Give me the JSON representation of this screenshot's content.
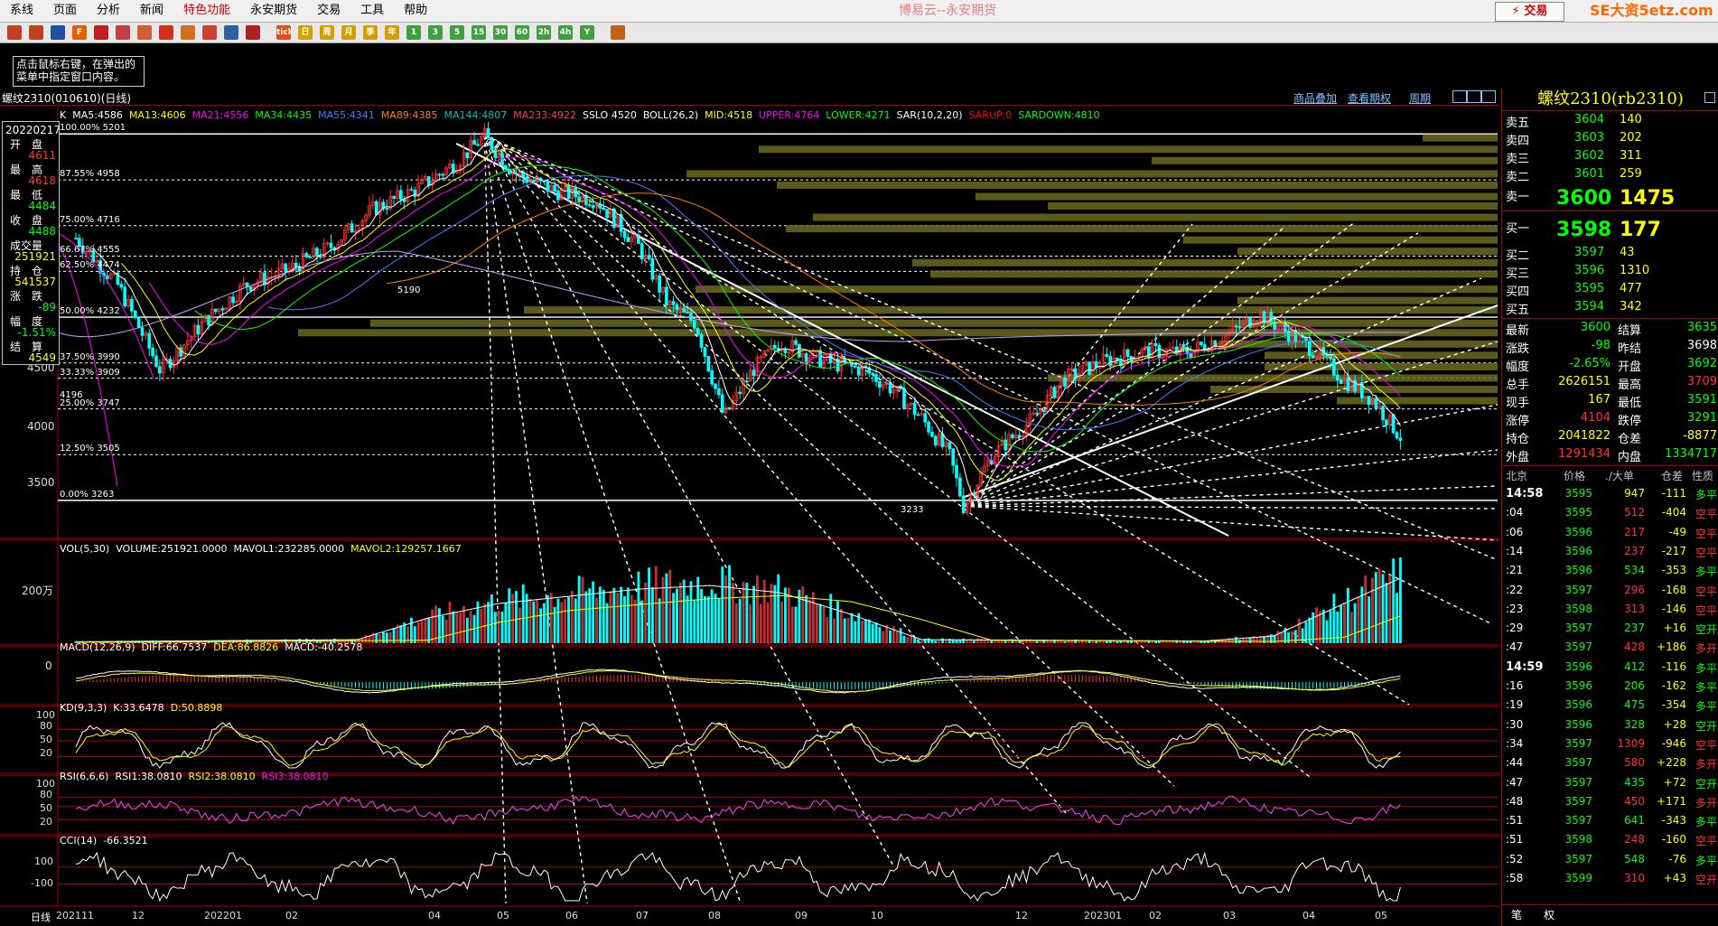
{
  "menu": {
    "items": [
      "系线",
      "页面",
      "分析",
      "新闻",
      "特色功能",
      "永安期货",
      "交易",
      "工具",
      "帮助"
    ],
    "highlight_index": 4,
    "app_title": "博易云--永安期货",
    "trade_button": "交易",
    "brand": "SE大资5etz.com"
  },
  "toolbar": {
    "icons": [
      {
        "name": "home-icon",
        "color": "#c04020",
        "text": ""
      },
      {
        "name": "pen-icon",
        "color": "#c04020",
        "text": ""
      },
      {
        "name": "window-icon",
        "color": "#2050a0",
        "text": ""
      },
      {
        "name": "f10-icon",
        "color": "#e06000",
        "text": "F"
      },
      {
        "name": "chart-icon",
        "color": "#c02020",
        "text": ""
      },
      {
        "name": "zoom-icon",
        "color": "#c04040",
        "text": ""
      },
      {
        "name": "search-icon",
        "color": "#d06030",
        "text": ""
      },
      {
        "name": "draw-icon",
        "color": "#d03020",
        "text": ""
      },
      {
        "name": "tool-icon",
        "color": "#d07020",
        "text": ""
      },
      {
        "name": "alarm-icon",
        "color": "#d04030",
        "text": ""
      },
      {
        "name": "quote-icon",
        "color": "#3060a0",
        "text": ""
      },
      {
        "name": "kline-icon",
        "color": "#b02020",
        "text": ""
      },
      {
        "name": "tick-icon",
        "color": "#e05010",
        "text": "tick"
      },
      {
        "name": "day-icon",
        "color": "#d0a000",
        "text": "日"
      },
      {
        "name": "week-icon",
        "color": "#d0a000",
        "text": "周"
      },
      {
        "name": "month-icon",
        "color": "#d0a000",
        "text": "月"
      },
      {
        "name": "season-icon",
        "color": "#d0a000",
        "text": "季"
      },
      {
        "name": "year-icon",
        "color": "#d0a000",
        "text": "年"
      },
      {
        "name": "min1-icon",
        "color": "#40a040",
        "text": "1"
      },
      {
        "name": "min3-icon",
        "color": "#40a040",
        "text": "3"
      },
      {
        "name": "min5-icon",
        "color": "#40a040",
        "text": "5"
      },
      {
        "name": "min15-icon",
        "color": "#40a040",
        "text": "15"
      },
      {
        "name": "min30-icon",
        "color": "#40a040",
        "text": "30"
      },
      {
        "name": "min60-icon",
        "color": "#40a040",
        "text": "60"
      },
      {
        "name": "hour2-icon",
        "color": "#40a040",
        "text": "2h"
      },
      {
        "name": "hour4-icon",
        "color": "#40a040",
        "text": "4h"
      },
      {
        "name": "custom-icon",
        "color": "#40a040",
        "text": "Y"
      },
      {
        "name": "calendar-icon",
        "color": "#c06020",
        "text": ""
      }
    ]
  },
  "hint": {
    "text": "点击鼠标右键，在弹出的菜单中指定窗口内容。"
  },
  "subtitle": {
    "name": "螺纹2310(010610)(日线)",
    "links": [
      "商品叠加",
      "查看期权",
      "周期"
    ]
  },
  "info": {
    "date": "20220217",
    "open_label": "开　盘",
    "open": "4611",
    "high_label": "最　高",
    "high": "4618",
    "low_label": "最　低",
    "low": "4484",
    "close_label": "收　盘",
    "close": "4488",
    "vol_label": "成交量",
    "vol": "251921",
    "oi_label": "持　仓",
    "oi": "541537",
    "chg_label": "涨　跌",
    "chg": "-89",
    "amp_label": "幅　度",
    "amp": "-1.51%",
    "settle_label": "结　算",
    "settle": "4549"
  },
  "main_header": [
    {
      "t": "K",
      "c": "#ffffff"
    },
    {
      "t": "MA5:4586",
      "c": "#ffffff"
    },
    {
      "t": "MA13:4606",
      "c": "#ffff00"
    },
    {
      "t": "MA21:4556",
      "c": "#ff00ff"
    },
    {
      "t": "MA34:4435",
      "c": "#00ff00"
    },
    {
      "t": "MA55:4341",
      "c": "#4080ff"
    },
    {
      "t": "MA89:4385",
      "c": "#ff8000"
    },
    {
      "t": "MA144:4807",
      "c": "#00c0c0"
    },
    {
      "t": "MA233:4922",
      "c": "#ff4040"
    },
    {
      "t": "SSLO 4520",
      "c": "#ffffff"
    },
    {
      "t": "BOLL(26,2)",
      "c": "#ffffff"
    },
    {
      "t": "MID:4518",
      "c": "#ffff00"
    },
    {
      "t": "UPPER:4764",
      "c": "#ff00ff"
    },
    {
      "t": "LOWER:4271",
      "c": "#00ff00"
    },
    {
      "t": "SAR(10,2,20)",
      "c": "#ffffff"
    },
    {
      "t": "SARUP:0",
      "c": "#ff0000"
    },
    {
      "t": "SARDOWN:4810",
      "c": "#00ff00"
    }
  ],
  "price_axis": [
    "4500",
    "4000",
    "3500"
  ],
  "fib_labels": [
    {
      "pct": "100.00%",
      "val": "5201"
    },
    {
      "pct": "87.55%",
      "val": "4958"
    },
    {
      "pct": "75.00%",
      "val": "4716"
    },
    {
      "pct": "66.67%",
      "val": "4555"
    },
    {
      "pct": "62.50%",
      "val": "4474"
    },
    {
      "pct": "50.00%",
      "val": "4232"
    },
    {
      "pct": "37.50%",
      "val": "3990"
    },
    {
      "pct": "33.33%",
      "val": "3909"
    },
    {
      "pct": "25.00%",
      "val": "3747"
    },
    {
      "pct": "12.50%",
      "val": "3505"
    },
    {
      "pct": "0.00%",
      "val": "3263"
    }
  ],
  "price_tags": {
    "high": "5190",
    "low": "3233",
    "mid": "4196"
  },
  "vol_header": [
    {
      "t": "VOL(5,30)",
      "c": "#ffffff"
    },
    {
      "t": "VOLUME:251921.0000",
      "c": "#ffffff"
    },
    {
      "t": "MAVOL1:232285.0000",
      "c": "#ffffff"
    },
    {
      "t": "MAVOL2:129257.1667",
      "c": "#ffff00"
    }
  ],
  "vol_axis": "200万",
  "macd_header": [
    {
      "t": "MACD(12,26,9)",
      "c": "#ffffff"
    },
    {
      "t": "DIFF:66.7537",
      "c": "#ffffff"
    },
    {
      "t": "DEA:86.8826",
      "c": "#ffff00"
    },
    {
      "t": "MACD:-40.2578",
      "c": "#ffffff"
    }
  ],
  "macd_axis": "0",
  "kd_header": [
    {
      "t": "KD(9,3,3)",
      "c": "#ffffff"
    },
    {
      "t": "K:33.6478",
      "c": "#ffffff"
    },
    {
      "t": "D:50.8898",
      "c": "#ffff00"
    }
  ],
  "kd_axis": [
    "100",
    "80",
    "50",
    "20"
  ],
  "rsi_header": [
    {
      "t": "RSI(6,6,6)",
      "c": "#ffffff"
    },
    {
      "t": "RSI1:38.0810",
      "c": "#ffffff"
    },
    {
      "t": "RSI2:38.0810",
      "c": "#ffff00"
    },
    {
      "t": "RSI3:38.0810",
      "c": "#ff00ff"
    }
  ],
  "rsi_axis": [
    "100",
    "80",
    "50",
    "20"
  ],
  "cci_header": [
    {
      "t": "CCI(14)",
      "c": "#ffffff"
    },
    {
      "t": "-66.3521",
      "c": "#ffffff"
    }
  ],
  "cci_axis": [
    "100",
    "-100"
  ],
  "date_axis": {
    "label": "日线",
    "ticks": [
      "202111",
      "12",
      "202201",
      "02",
      "04",
      "05",
      "06",
      "07",
      "08",
      "09",
      "10",
      "12",
      "202301",
      "02",
      "03",
      "04",
      "05"
    ]
  },
  "panel": {
    "title": "螺纹2310(rb2310)",
    "asks": [
      {
        "l": "卖五",
        "p": "3604",
        "v": "140"
      },
      {
        "l": "卖四",
        "p": "3603",
        "v": "202"
      },
      {
        "l": "卖三",
        "p": "3602",
        "v": "311"
      },
      {
        "l": "卖二",
        "p": "3601",
        "v": "259"
      }
    ],
    "ask1": {
      "l": "卖一",
      "p": "3600",
      "v": "1475"
    },
    "bid1": {
      "l": "买一",
      "p": "3598",
      "v": "177"
    },
    "bids": [
      {
        "l": "买二",
        "p": "3597",
        "v": "43"
      },
      {
        "l": "买三",
        "p": "3596",
        "v": "1310"
      },
      {
        "l": "买四",
        "p": "3595",
        "v": "477"
      },
      {
        "l": "买五",
        "p": "3594",
        "v": "342"
      }
    ],
    "stats": [
      {
        "l1": "最新",
        "v1": "3600",
        "c1": "#00ff00",
        "l2": "结算",
        "v2": "3635",
        "c2": "#00ff00"
      },
      {
        "l1": "涨跌",
        "v1": "-98",
        "c1": "#00ff00",
        "l2": "昨结",
        "v2": "3698",
        "c2": "#ffffff"
      },
      {
        "l1": "幅度",
        "v1": "-2.65%",
        "c1": "#00ff00",
        "l2": "开盘",
        "v2": "3692",
        "c2": "#00ff00"
      },
      {
        "l1": "总手",
        "v1": "2626151",
        "c1": "#ffff00",
        "l2": "最高",
        "v2": "3709",
        "c2": "#ff3030"
      },
      {
        "l1": "现手",
        "v1": "167",
        "c1": "#ffff00",
        "l2": "最低",
        "v2": "3591",
        "c2": "#00ff00"
      },
      {
        "l1": "涨停",
        "v1": "4104",
        "c1": "#ff3030",
        "l2": "跌停",
        "v2": "3291",
        "c2": "#00ff00"
      },
      {
        "l1": "持仓",
        "v1": "2041822",
        "c1": "#ffff00",
        "l2": "仓差",
        "v2": "-8877",
        "c2": "#ffff00"
      },
      {
        "l1": "外盘",
        "v1": "1291434",
        "c1": "#ff3030",
        "l2": "内盘",
        "v2": "1334717",
        "c2": "#00ff00"
      }
    ],
    "tick_headers": [
      "北京",
      "价格",
      "./大单",
      "仓差",
      "性质"
    ],
    "ticks": [
      {
        "t": "14:58",
        "p": "3595",
        "v": "947",
        "vc": "#ffff00",
        "d": "-111",
        "n": "多平",
        "nc": "#00ff00"
      },
      {
        "t": ":04",
        "p": "3595",
        "v": "512",
        "vc": "#ff3030",
        "d": "-404",
        "n": "空平",
        "nc": "#ff3030"
      },
      {
        "t": ":06",
        "p": "3596",
        "v": "217",
        "vc": "#ff3030",
        "d": "-49",
        "n": "空平",
        "nc": "#ff3030"
      },
      {
        "t": ":14",
        "p": "3596",
        "v": "237",
        "vc": "#ff3030",
        "d": "-217",
        "n": "空平",
        "nc": "#ff3030"
      },
      {
        "t": ":21",
        "p": "3596",
        "v": "534",
        "vc": "#00ff00",
        "d": "-353",
        "n": "多平",
        "nc": "#00ff00"
      },
      {
        "t": ":22",
        "p": "3597",
        "v": "296",
        "vc": "#ff3030",
        "d": "-168",
        "n": "空平",
        "nc": "#ff3030"
      },
      {
        "t": ":23",
        "p": "3598",
        "v": "313",
        "vc": "#ff3030",
        "d": "-146",
        "n": "空平",
        "nc": "#ff3030"
      },
      {
        "t": ":29",
        "p": "3597",
        "v": "237",
        "vc": "#00ff00",
        "d": "+16",
        "n": "空开",
        "nc": "#00ff00"
      },
      {
        "t": ":47",
        "p": "3597",
        "v": "428",
        "vc": "#ff3030",
        "d": "+186",
        "n": "多开",
        "nc": "#ff3030"
      },
      {
        "t": "14:59",
        "p": "3596",
        "v": "412",
        "vc": "#00ff00",
        "d": "-116",
        "n": "多平",
        "nc": "#00ff00"
      },
      {
        "t": ":16",
        "p": "3596",
        "v": "206",
        "vc": "#00ff00",
        "d": "-162",
        "n": "多平",
        "nc": "#00ff00"
      },
      {
        "t": ":19",
        "p": "3596",
        "v": "475",
        "vc": "#00ff00",
        "d": "-354",
        "n": "多平",
        "nc": "#00ff00"
      },
      {
        "t": ":30",
        "p": "3596",
        "v": "328",
        "vc": "#00ff00",
        "d": "+28",
        "n": "空开",
        "nc": "#00ff00"
      },
      {
        "t": ":34",
        "p": "3597",
        "v": "1309",
        "vc": "#ff3030",
        "d": "-946",
        "n": "空平",
        "nc": "#ff3030"
      },
      {
        "t": ":44",
        "p": "3597",
        "v": "580",
        "vc": "#ff3030",
        "d": "+228",
        "n": "多开",
        "nc": "#ff3030"
      },
      {
        "t": ":47",
        "p": "3597",
        "v": "435",
        "vc": "#00ff00",
        "d": "+72",
        "n": "空开",
        "nc": "#00ff00"
      },
      {
        "t": ":48",
        "p": "3597",
        "v": "450",
        "vc": "#ff3030",
        "d": "+171",
        "n": "多开",
        "nc": "#ff3030"
      },
      {
        "t": ":51",
        "p": "3597",
        "v": "641",
        "vc": "#00ff00",
        "d": "-343",
        "n": "多平",
        "nc": "#00ff00"
      },
      {
        "t": ":51",
        "p": "3598",
        "v": "248",
        "vc": "#ff3030",
        "d": "-160",
        "n": "空平",
        "nc": "#ff3030"
      },
      {
        "t": ":52",
        "p": "3597",
        "v": "548",
        "vc": "#00ff00",
        "d": "-76",
        "n": "多平",
        "nc": "#00ff00"
      },
      {
        "t": ":58",
        "p": "3599",
        "v": "310",
        "vc": "#ff3030",
        "d": "+43",
        "n": "空开",
        "nc": "#ff3030"
      }
    ],
    "bottom_tabs": [
      "笔",
      "权"
    ]
  },
  "colors": {
    "up": "#ff3030",
    "down": "#00ffff",
    "frame": "#aa0000",
    "fib_band": "#6a6a20"
  },
  "chart_data": [
    {
      "type": "candlestick",
      "title": "螺纹2310(010610)(日线)",
      "period": "daily",
      "x_range": [
        "2021-11",
        "2023-05"
      ],
      "ylim": [
        3100,
        5250
      ],
      "close_path": [
        [
          0,
          4650
        ],
        [
          0.03,
          4400
        ],
        [
          0.06,
          3950
        ],
        [
          0.09,
          4200
        ],
        [
          0.12,
          4400
        ],
        [
          0.15,
          4480
        ],
        [
          0.18,
          4600
        ],
        [
          0.21,
          4800
        ],
        [
          0.24,
          4900
        ],
        [
          0.27,
          5050
        ],
        [
          0.29,
          5190
        ],
        [
          0.31,
          5000
        ],
        [
          0.34,
          4900
        ],
        [
          0.37,
          4850
        ],
        [
          0.4,
          4600
        ],
        [
          0.42,
          4300
        ],
        [
          0.44,
          4200
        ],
        [
          0.46,
          3700
        ],
        [
          0.48,
          3950
        ],
        [
          0.5,
          4100
        ],
        [
          0.53,
          4000
        ],
        [
          0.56,
          3950
        ],
        [
          0.58,
          3850
        ],
        [
          0.6,
          3700
        ],
        [
          0.62,
          3500
        ],
        [
          0.63,
          3233
        ],
        [
          0.65,
          3500
        ],
        [
          0.68,
          3700
        ],
        [
          0.7,
          3900
        ],
        [
          0.73,
          4000
        ],
        [
          0.76,
          4050
        ],
        [
          0.79,
          4050
        ],
        [
          0.82,
          4150
        ],
        [
          0.84,
          4250
        ],
        [
          0.86,
          4150
        ],
        [
          0.88,
          4050
        ],
        [
          0.9,
          3900
        ],
        [
          0.92,
          3800
        ],
        [
          0.94,
          3600
        ]
      ]
    },
    {
      "type": "bar",
      "title": "VOL(5,30)",
      "volume_path": [
        [
          0,
          0.02
        ],
        [
          0.2,
          0.05
        ],
        [
          0.25,
          0.35
        ],
        [
          0.3,
          0.55
        ],
        [
          0.4,
          0.75
        ],
        [
          0.45,
          0.8
        ],
        [
          0.5,
          0.7
        ],
        [
          0.55,
          0.4
        ],
        [
          0.6,
          0.05
        ],
        [
          0.8,
          0.03
        ],
        [
          0.85,
          0.1
        ],
        [
          0.9,
          0.55
        ],
        [
          0.94,
          0.9
        ]
      ]
    }
  ]
}
